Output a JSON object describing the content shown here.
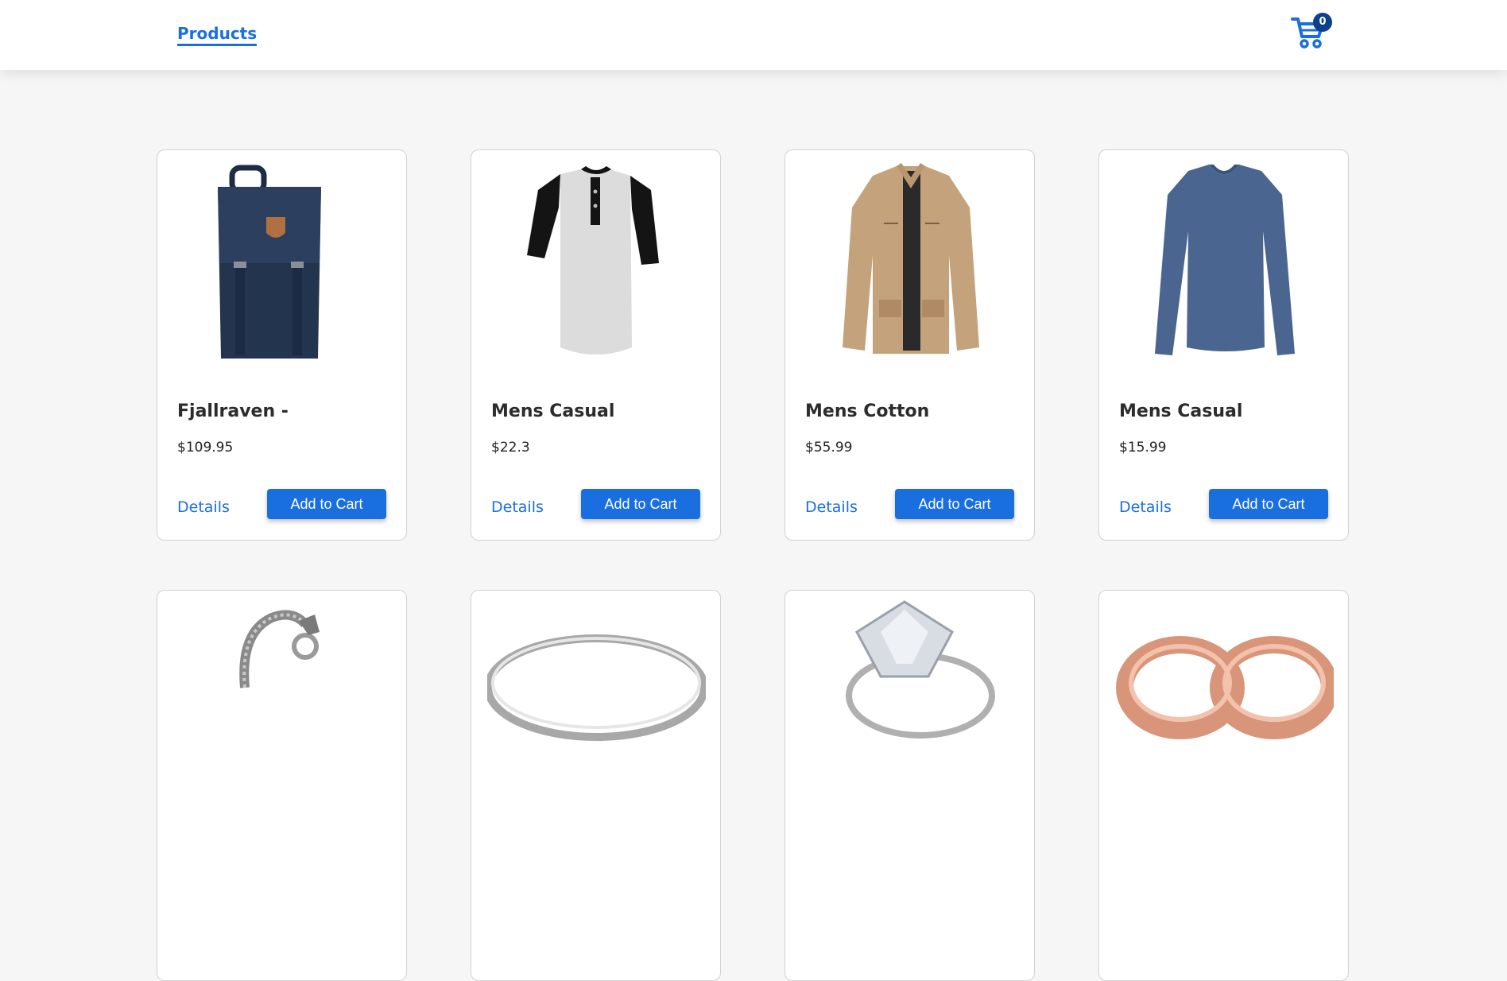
{
  "nav": {
    "products_label": "Products",
    "cart_count": "0"
  },
  "colors": {
    "accent": "#1a6fe0",
    "badge": "#0d3f8c",
    "background": "#f6f6f6"
  },
  "buttons": {
    "details_label": "Details",
    "add_to_cart_label": "Add to Cart"
  },
  "products": [
    {
      "title": "Fjallraven -",
      "price": "$109.95",
      "image": "navy-backpack"
    },
    {
      "title": "Mens Casual",
      "price": "$22.3",
      "image": "raglan-henley-tshirt"
    },
    {
      "title": "Mens Cotton",
      "price": "$55.99",
      "image": "tan-cotton-jacket"
    },
    {
      "title": "Mens Casual",
      "price": "$15.99",
      "image": "blue-longsleeve-shirt"
    },
    {
      "image": "silver-dragon-bracelet"
    },
    {
      "image": "silver-ring"
    },
    {
      "image": "diamond-ring"
    },
    {
      "image": "rose-gold-rings"
    }
  ]
}
